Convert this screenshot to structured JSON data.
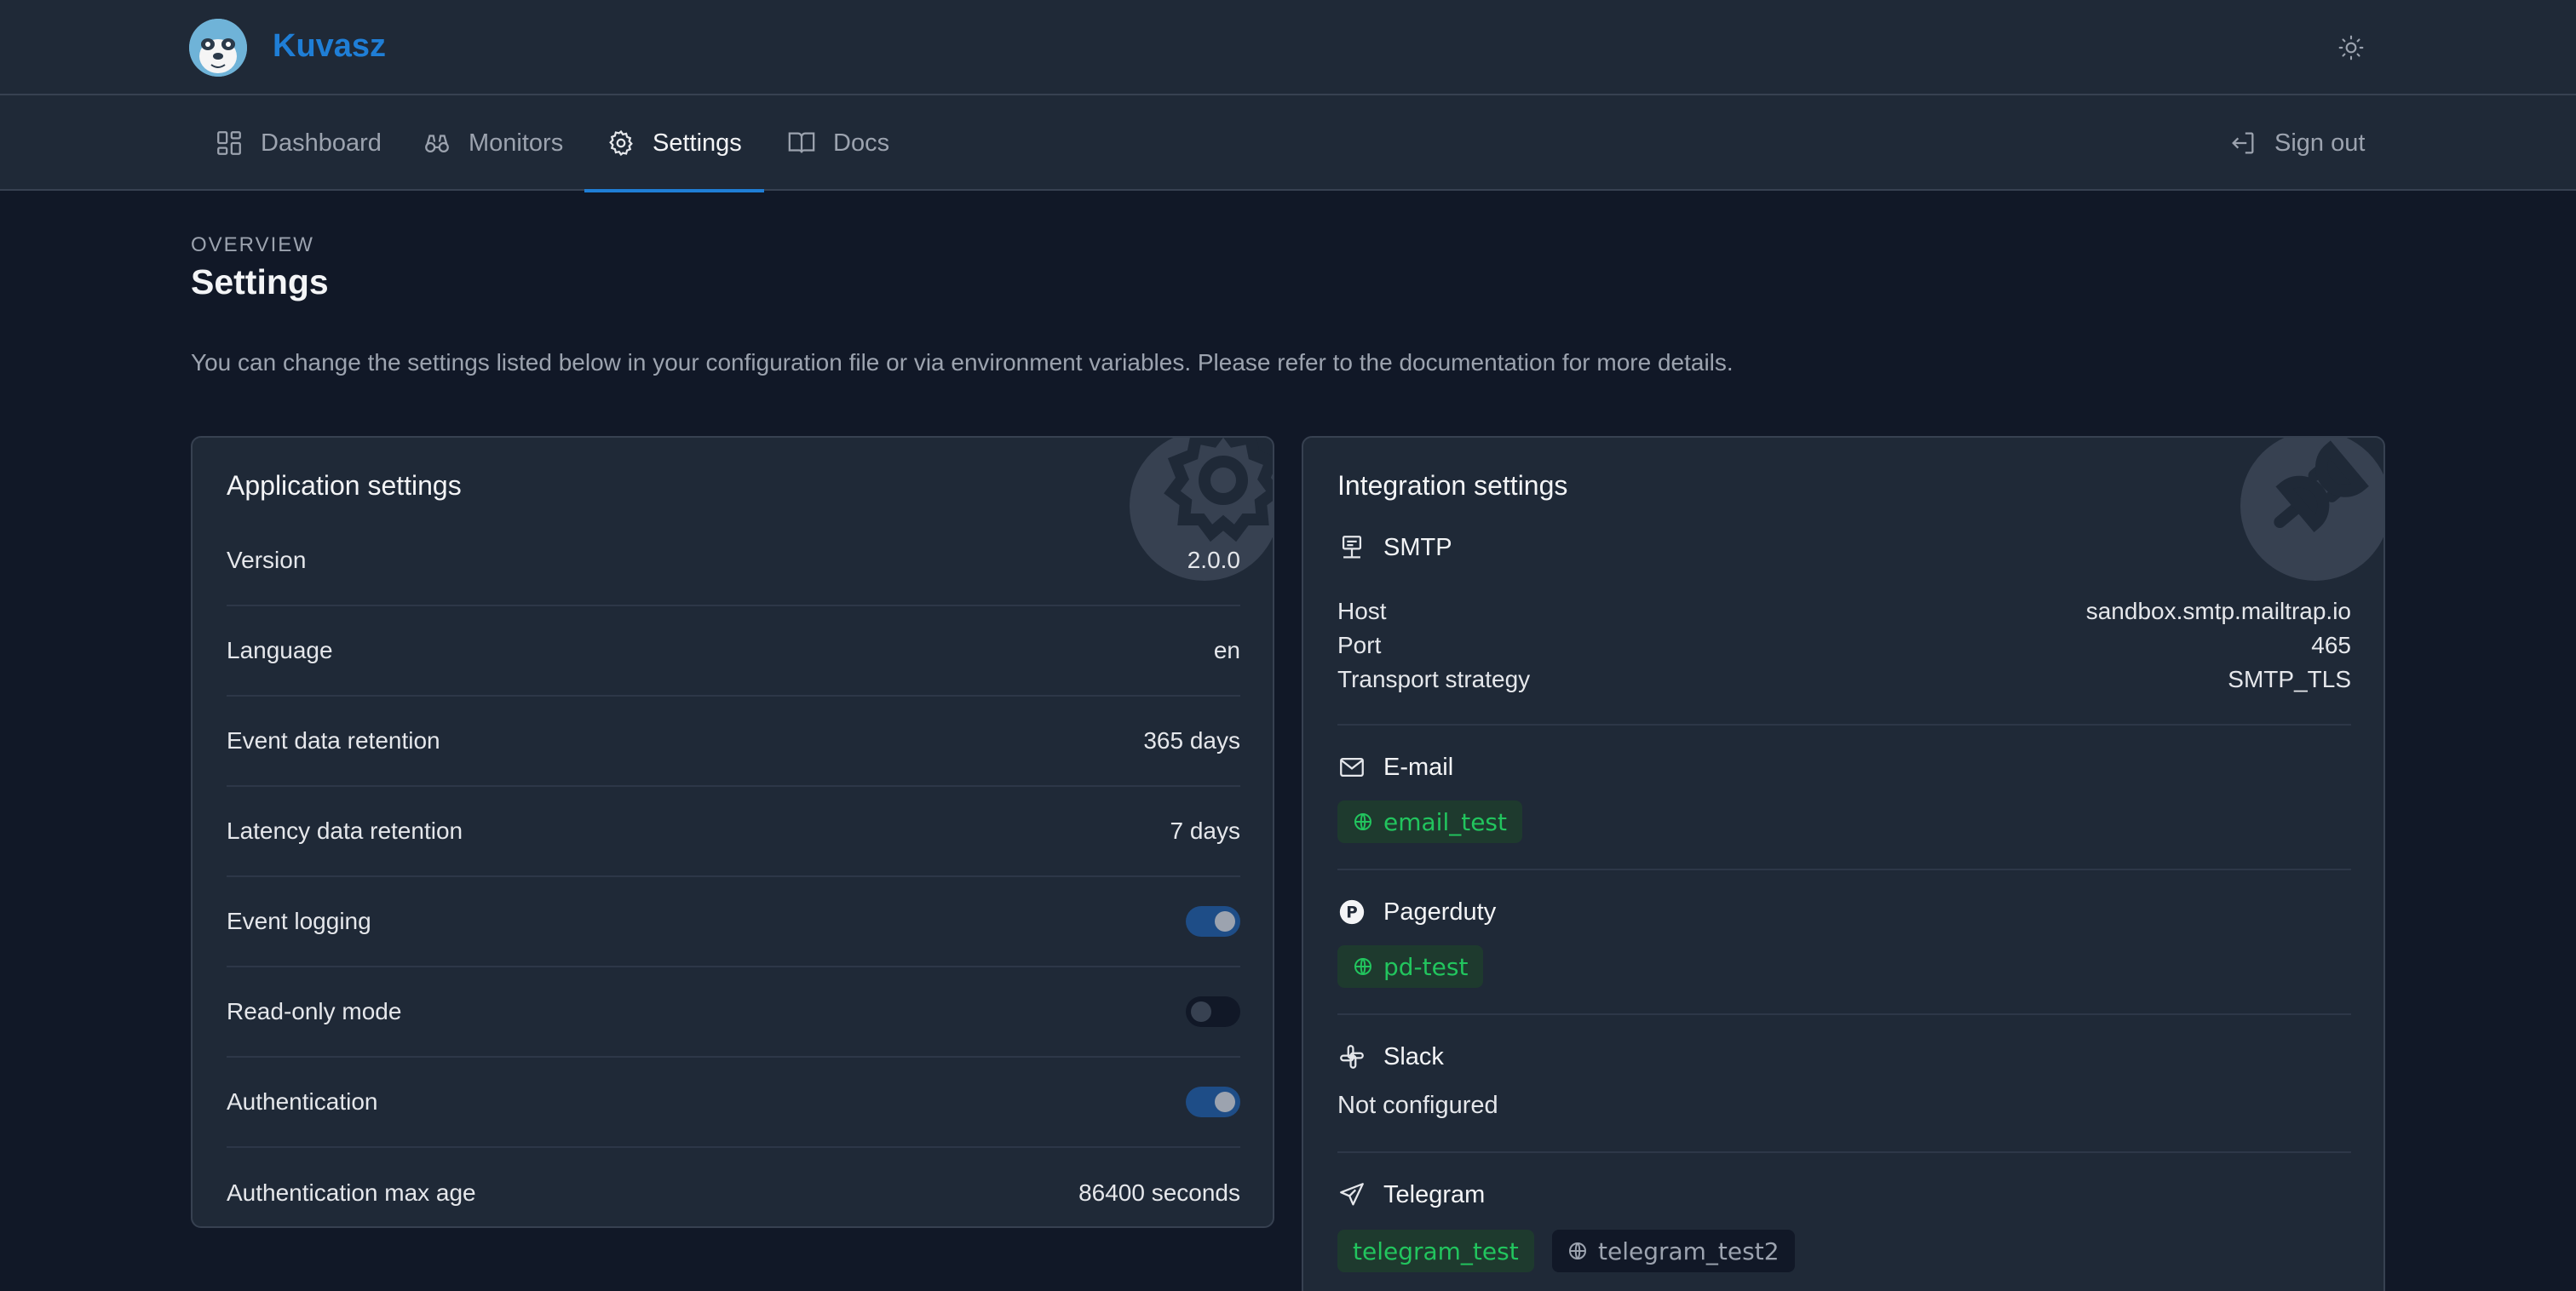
{
  "app": {
    "name": "Kuvasz"
  },
  "nav": {
    "items": [
      {
        "label": "Dashboard",
        "icon": "dashboard-icon"
      },
      {
        "label": "Monitors",
        "icon": "binoculars-icon"
      },
      {
        "label": "Settings",
        "icon": "gear-icon",
        "active": true
      },
      {
        "label": "Docs",
        "icon": "book-icon"
      }
    ],
    "sign_out": "Sign out"
  },
  "page": {
    "eyebrow": "OVERVIEW",
    "title": "Settings",
    "description": "You can change the settings listed below in your configuration file or via environment variables. Please refer to the documentation for more details."
  },
  "application_settings": {
    "title": "Application settings",
    "rows": [
      {
        "label": "Version",
        "value": "2.0.0"
      },
      {
        "label": "Language",
        "value": "en"
      },
      {
        "label": "Event data retention",
        "value": "365 days"
      },
      {
        "label": "Latency data retention",
        "value": "7 days"
      },
      {
        "label": "Event logging",
        "toggle": "on"
      },
      {
        "label": "Read-only mode",
        "toggle": "off"
      },
      {
        "label": "Authentication",
        "toggle": "on"
      },
      {
        "label": "Authentication max age",
        "value": "86400 seconds"
      }
    ]
  },
  "integration_settings": {
    "title": "Integration settings",
    "smtp": {
      "label": "SMTP",
      "rows": [
        {
          "label": "Host",
          "value": "sandbox.smtp.mailtrap.io"
        },
        {
          "label": "Port",
          "value": "465"
        },
        {
          "label": "Transport strategy",
          "value": "SMTP_TLS"
        }
      ]
    },
    "email": {
      "label": "E-mail",
      "badges": [
        "email_test"
      ]
    },
    "pagerduty": {
      "label": "Pagerduty",
      "badges": [
        "pd-test"
      ]
    },
    "slack": {
      "label": "Slack",
      "status": "Not configured"
    },
    "telegram": {
      "label": "Telegram",
      "badges": [
        "telegram_test",
        "telegram_test2"
      ]
    }
  },
  "colors": {
    "background": "#111827",
    "surface": "#1f2937",
    "accent": "#1f7ed6",
    "success": "#22c55e",
    "toggle_on": "#1e4d87"
  }
}
